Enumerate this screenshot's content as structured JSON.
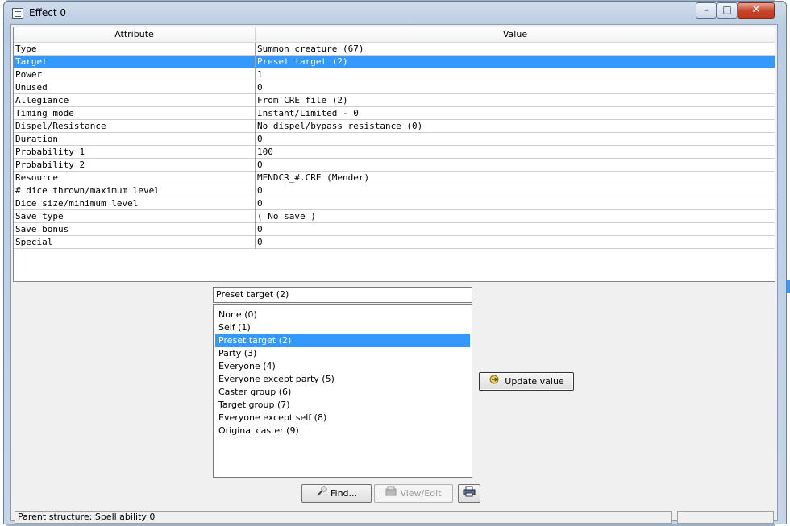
{
  "window": {
    "title": "Effect 0",
    "controls": {
      "minimize": "–",
      "maximize": "□",
      "close": "✕"
    }
  },
  "grid": {
    "headers": {
      "attribute": "Attribute",
      "value": "Value"
    },
    "rows": [
      {
        "attr": "Type",
        "value": "Summon creature (67)"
      },
      {
        "attr": "Target",
        "value": "Preset target (2)"
      },
      {
        "attr": "Power",
        "value": "1"
      },
      {
        "attr": "Unused",
        "value": "0"
      },
      {
        "attr": "Allegiance",
        "value": "From CRE file (2)"
      },
      {
        "attr": "Timing mode",
        "value": "Instant/Limited - 0"
      },
      {
        "attr": "Dispel/Resistance",
        "value": "No dispel/bypass resistance (0)"
      },
      {
        "attr": "Duration",
        "value": "0"
      },
      {
        "attr": "Probability 1",
        "value": "100"
      },
      {
        "attr": "Probability 2",
        "value": "0"
      },
      {
        "attr": "Resource",
        "value": "MENDCR_#.CRE (Mender)"
      },
      {
        "attr": "# dice thrown/maximum level",
        "value": "0"
      },
      {
        "attr": "Dice size/minimum level",
        "value": "0"
      },
      {
        "attr": "Save type",
        "value": "( No save )"
      },
      {
        "attr": "Save bonus",
        "value": "0"
      },
      {
        "attr": "Special",
        "value": "0"
      }
    ],
    "selected_row": 1
  },
  "editor": {
    "current_value": "Preset target (2)",
    "options": [
      "None (0)",
      "Self (1)",
      "Preset target (2)",
      "Party (3)",
      "Everyone (4)",
      "Everyone except party (5)",
      "Caster group (6)",
      "Target group (7)",
      "Everyone except self (8)",
      "Original caster (9)"
    ],
    "selected_option": 2,
    "update_label": "Update value"
  },
  "footer": {
    "find_label": "Find...",
    "view_edit_label": "View/Edit",
    "status_text": "Parent structure: Spell ability 0"
  },
  "colors": {
    "selection": "#3399ff"
  }
}
